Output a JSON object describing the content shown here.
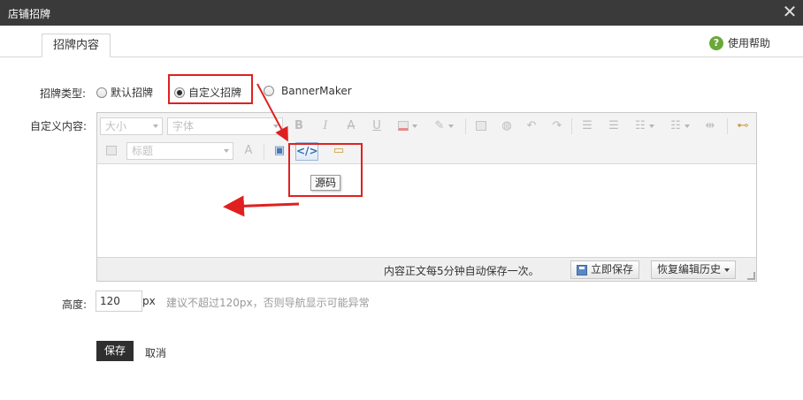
{
  "window": {
    "title": "店铺招牌"
  },
  "tab": {
    "label": "招牌内容"
  },
  "help": {
    "label": "使用帮助",
    "icon_glyph": "?"
  },
  "form": {
    "type_label": "招牌类型:",
    "options": [
      "默认招牌",
      "自定义招牌",
      "BannerMaker"
    ],
    "selected": "自定义招牌",
    "content_label": "自定义内容:",
    "height_label": "高度:",
    "height_value": "120",
    "height_unit": "px",
    "height_hint": "建议不超过120px，否则导航显示可能异常",
    "save_label": "保存",
    "cancel_label": "取消"
  },
  "editor": {
    "size_placeholder": "大小",
    "font_placeholder": "字体",
    "heading_placeholder": "标题",
    "tooltip": "源码",
    "status_text": "内容正文每5分钟自动保存一次。",
    "save_now_label": "立即保存",
    "restore_label": "恢复编辑历史"
  },
  "colors": {
    "titlebar": "#3a3a3a",
    "annotation": "#e02020",
    "save_button": "#2f2f2f"
  }
}
